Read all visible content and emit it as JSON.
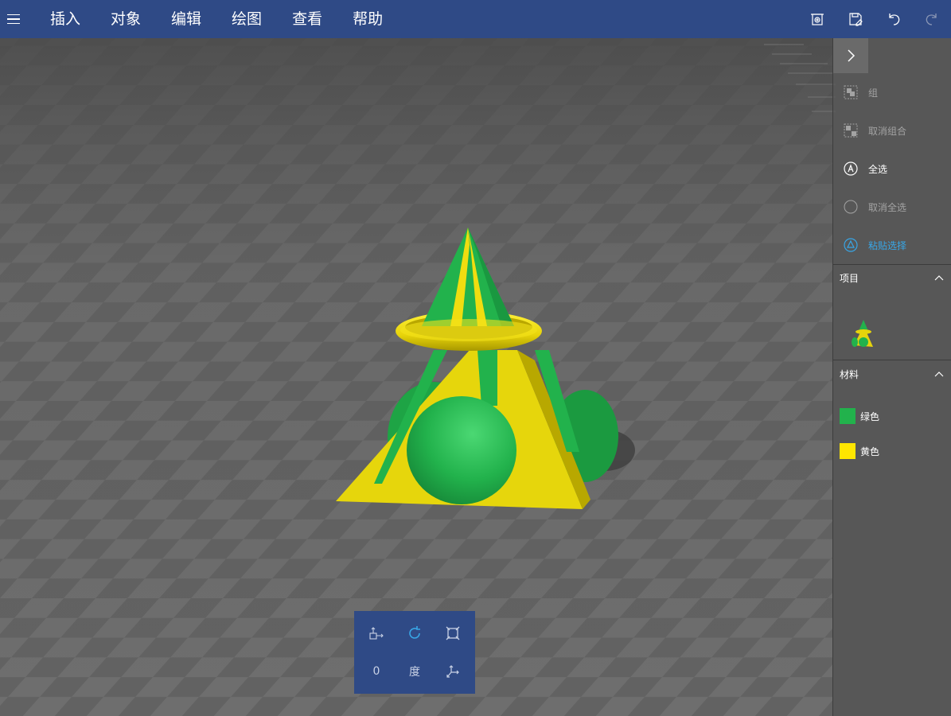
{
  "menu": {
    "items": [
      "插入",
      "对象",
      "编辑",
      "绘图",
      "查看",
      "帮助"
    ]
  },
  "toolbar": {
    "icons": [
      "3d-view-icon",
      "save-icon",
      "undo-icon",
      "redo-icon"
    ]
  },
  "panel": {
    "commands": [
      {
        "label": "组",
        "icon": "group-icon",
        "state": "disabled"
      },
      {
        "label": "取消组合",
        "icon": "ungroup-icon",
        "state": "disabled"
      },
      {
        "label": "全选",
        "icon": "select-all-icon",
        "state": "active"
      },
      {
        "label": "取消全选",
        "icon": "deselect-all-icon",
        "state": "disabled"
      },
      {
        "label": "粘贴选择",
        "icon": "paste-selection-icon",
        "state": "accent"
      }
    ],
    "sections": {
      "items_title": "项目",
      "materials_title": "材料"
    },
    "materials": [
      {
        "name": "绿色",
        "color": "#22b24c"
      },
      {
        "name": "黄色",
        "color": "#ffe600"
      }
    ]
  },
  "rotate_widget": {
    "angle_value": "0",
    "angle_unit": "度"
  },
  "colors": {
    "menubar": "#2f4a86",
    "accent": "#38a6e6",
    "green": "#22b24c",
    "yellow": "#e6d40c"
  }
}
